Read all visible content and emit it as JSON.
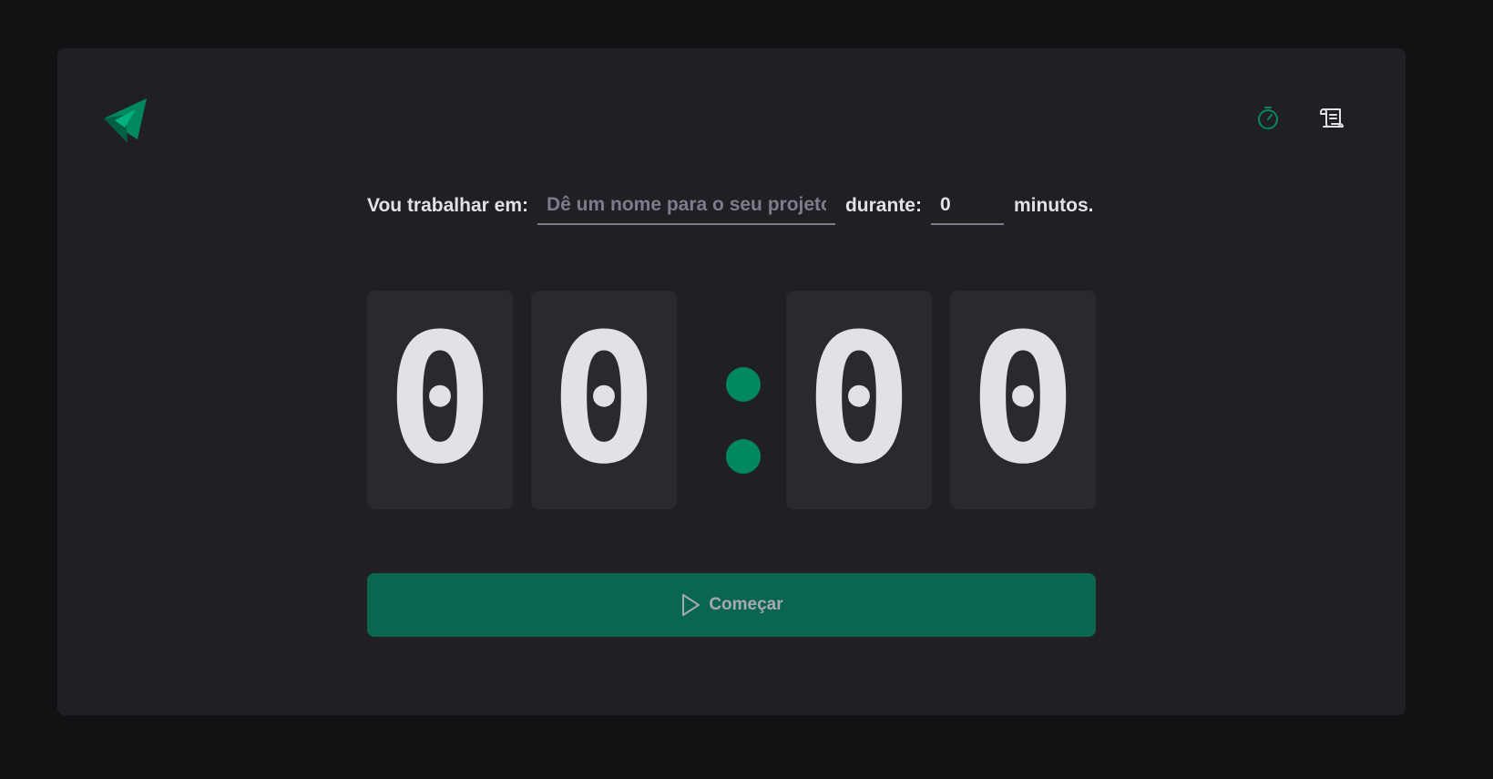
{
  "app": {
    "brand_color": "#00875f",
    "background_color": "#121214",
    "card_color": "#202024"
  },
  "header": {
    "logo_icon": "paper-plane-logo-icon",
    "nav": [
      {
        "icon": "timer-icon",
        "active": true
      },
      {
        "icon": "history-scroll-icon",
        "active": false
      }
    ]
  },
  "form": {
    "project_label": "Vou trabalhar em:",
    "project_value": "",
    "project_placeholder": "Dê um nome para o seu projeto",
    "duration_label": "durante:",
    "minutes_value": "0",
    "minutes_suffix": "minutos."
  },
  "countdown": {
    "minutes_tens": "0",
    "minutes_ones": "0",
    "separator": ":",
    "seconds_tens": "0",
    "seconds_ones": "0"
  },
  "start_button": {
    "label": "Começar",
    "icon": "play-icon",
    "disabled": true
  }
}
